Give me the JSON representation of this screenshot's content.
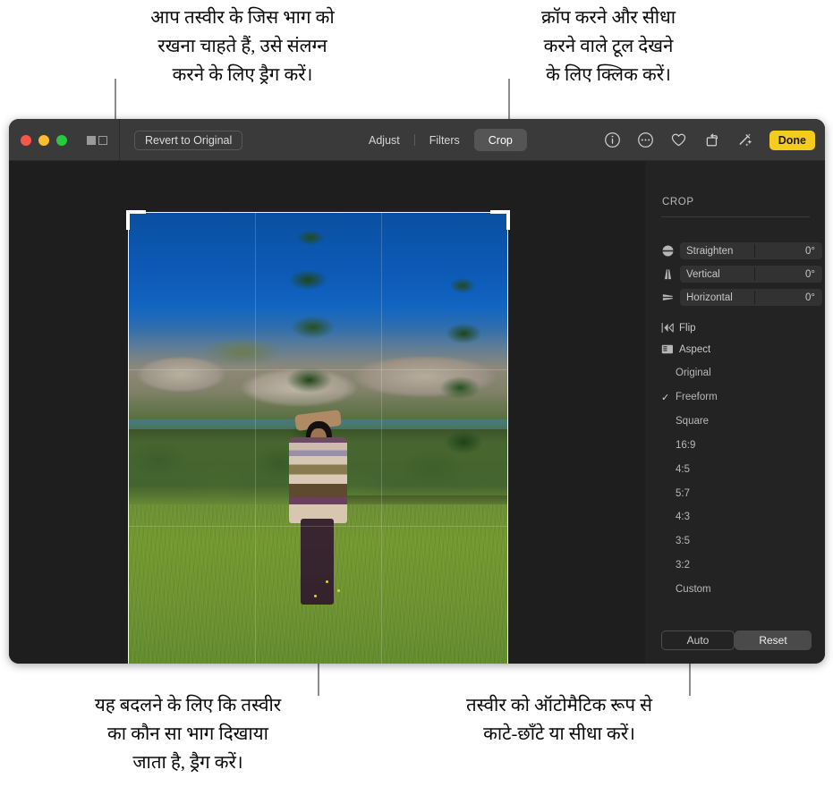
{
  "callouts": {
    "top_left": "आप तस्वीर के जिस भाग को\nरखना चाहते हैं, उसे संलग्न\nकरने के लिए ड्रैग करें।",
    "top_right": "क्रॉप करने और सीधा\nकरने वाले टूल देखने\nके लिए क्लिक करें।",
    "bottom_left": "यह बदलने के लिए कि तस्वीर\nका कौन सा भाग दिखाया\nजाता है, ड्रैग करें।",
    "bottom_right": "तस्वीर को ऑटोमैटिक रूप से\nकाटे-छाँटे या सीधा करें।"
  },
  "titlebar": {
    "revert_label": "Revert to Original",
    "tabs": [
      {
        "label": "Adjust",
        "selected": false
      },
      {
        "label": "Filters",
        "selected": false
      },
      {
        "label": "Crop",
        "selected": true
      }
    ],
    "icons": [
      "info-icon",
      "more-options-icon",
      "favorite-heart-icon",
      "rotate-icon",
      "auto-enhance-icon"
    ],
    "done_label": "Done"
  },
  "panel": {
    "title": "CROP",
    "sliders": [
      {
        "icon": "straighten-icon",
        "label": "Straighten",
        "value": "0°"
      },
      {
        "icon": "vertical-perspective-icon",
        "label": "Vertical",
        "value": "0°"
      },
      {
        "icon": "horizontal-perspective-icon",
        "label": "Horizontal",
        "value": "0°"
      }
    ],
    "flip_label": "Flip",
    "aspect_label": "Aspect",
    "aspect_options": [
      {
        "label": "Original",
        "checked": false
      },
      {
        "label": "Freeform",
        "checked": true
      },
      {
        "label": "Square",
        "checked": false
      },
      {
        "label": "16:9",
        "checked": false
      },
      {
        "label": "4:5",
        "checked": false
      },
      {
        "label": "5:7",
        "checked": false
      },
      {
        "label": "4:3",
        "checked": false
      },
      {
        "label": "3:5",
        "checked": false
      },
      {
        "label": "3:2",
        "checked": false
      },
      {
        "label": "Custom",
        "checked": false
      }
    ],
    "auto_label": "Auto",
    "reset_label": "Reset"
  },
  "colors": {
    "accent_done": "#f5cc1d",
    "window_bg": "#1e1e1e",
    "titlebar_bg": "#3a3a3a",
    "panel_bg": "#232323",
    "traffic_red": "#f9564a",
    "traffic_yellow": "#f9bd2d",
    "traffic_green": "#27c93f"
  }
}
